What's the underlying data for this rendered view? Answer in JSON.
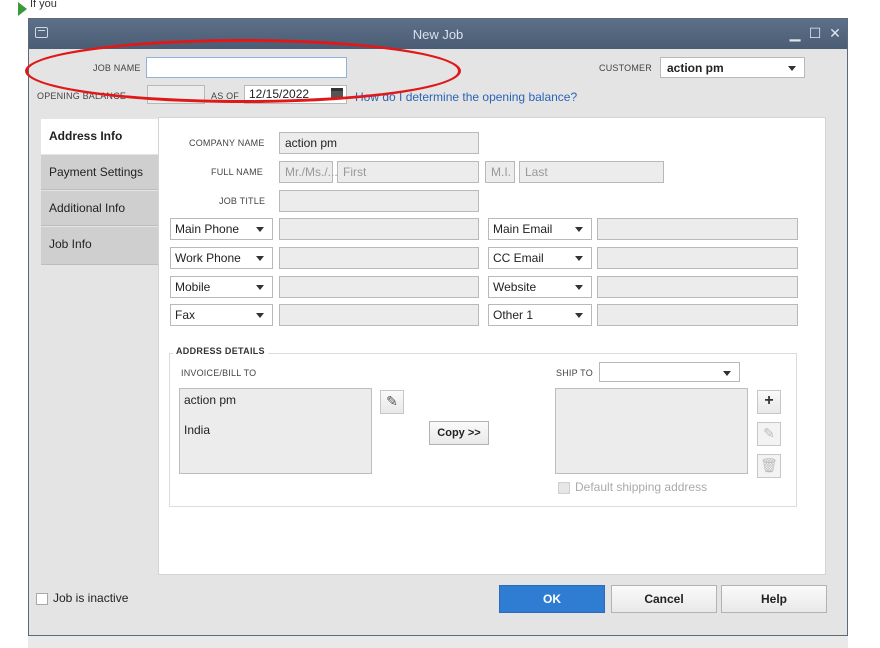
{
  "window": {
    "title": "New Job"
  },
  "header": {
    "job_name_label": "JOB NAME",
    "job_name_value": "",
    "customer_label": "CUSTOMER",
    "customer_value": "action pm",
    "opening_balance_label": "OPENING BALANCE",
    "as_of_label": "AS OF",
    "as_of_value": "12/15/2022",
    "opening_balance_link": "How do I determine the opening balance?"
  },
  "tabs": [
    {
      "label": "Address Info",
      "active": true
    },
    {
      "label": "Payment Settings",
      "active": false
    },
    {
      "label": "Additional Info",
      "active": false
    },
    {
      "label": "Job Info",
      "active": false
    }
  ],
  "address_info": {
    "company_name_label": "COMPANY NAME",
    "company_name_value": "action pm",
    "full_name_label": "FULL NAME",
    "salutation_placeholder": "Mr./Ms./...",
    "first_placeholder": "First",
    "mi_placeholder": "M.I.",
    "last_placeholder": "Last",
    "job_title_label": "JOB TITLE",
    "phone_rows": [
      {
        "left": "Main Phone",
        "right": "Main Email"
      },
      {
        "left": "Work Phone",
        "right": "CC Email"
      },
      {
        "left": "Mobile",
        "right": "Website"
      },
      {
        "left": "Fax",
        "right": "Other 1"
      }
    ]
  },
  "address_details": {
    "section_title": "ADDRESS DETAILS",
    "bill_to_label": "INVOICE/BILL TO",
    "bill_to_line1": "action pm",
    "bill_to_line2": "India",
    "copy_button": "Copy >>",
    "ship_to_label": "SHIP TO",
    "ship_to_value": "",
    "default_shipping_label": "Default shipping address"
  },
  "footer": {
    "inactive_label": "Job is inactive",
    "ok": "OK",
    "cancel": "Cancel",
    "help": "Help"
  },
  "background": {
    "fragment_text": "If you"
  },
  "colors": {
    "titlebar": "#4b5d75",
    "primary_button": "#2f7dd3",
    "link": "#2a64b8",
    "annotation": "#e01818"
  }
}
